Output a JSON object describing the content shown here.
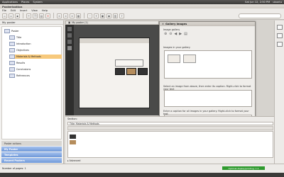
{
  "system_bar": {
    "menus": [
      "Applications",
      "Places",
      "System"
    ],
    "time": "Sat Jun 12, 2:50 PM",
    "user": "ubuntu"
  },
  "window": {
    "title": "Posterization"
  },
  "menubar": [
    "File",
    "Edit",
    "Insert",
    "View",
    "Help"
  ],
  "left_panel": {
    "title": "My poster",
    "tree": [
      {
        "label": "Poster",
        "level": 0
      },
      {
        "label": "Title",
        "level": 1
      },
      {
        "label": "Introduction",
        "level": 1
      },
      {
        "label": "Objectives",
        "level": 1
      },
      {
        "label": "Materials & Methods",
        "level": 1,
        "selected": true
      },
      {
        "label": "Results",
        "level": 1
      },
      {
        "label": "Conclusions",
        "level": 1
      },
      {
        "label": "References",
        "level": 1
      }
    ],
    "poster_actions": "Poster actions",
    "sections": [
      "My Poster",
      "Templates",
      "Recent Posters"
    ]
  },
  "document_tab": {
    "label": "My poster (1)"
  },
  "dialog": {
    "title": "Gallery images",
    "image_gallery_label": "Image gallery",
    "images_label": "Images in your gallery",
    "select_hint": "Select an image from above, then enter its caption. Right-click to format your text",
    "caption_hint": "Enter a caption for all images in your gallery. Right-click to format your text",
    "show_properties": "Show properties",
    "apply": "Apply",
    "cancel": "Cancel"
  },
  "section_pane": {
    "header": "Section:",
    "title_label": "Title: Materials & Methods",
    "advanced": "Advanced"
  },
  "status": {
    "page_info": "Number of pages: 1",
    "badge": "Optimal display/printing: 1:1"
  }
}
